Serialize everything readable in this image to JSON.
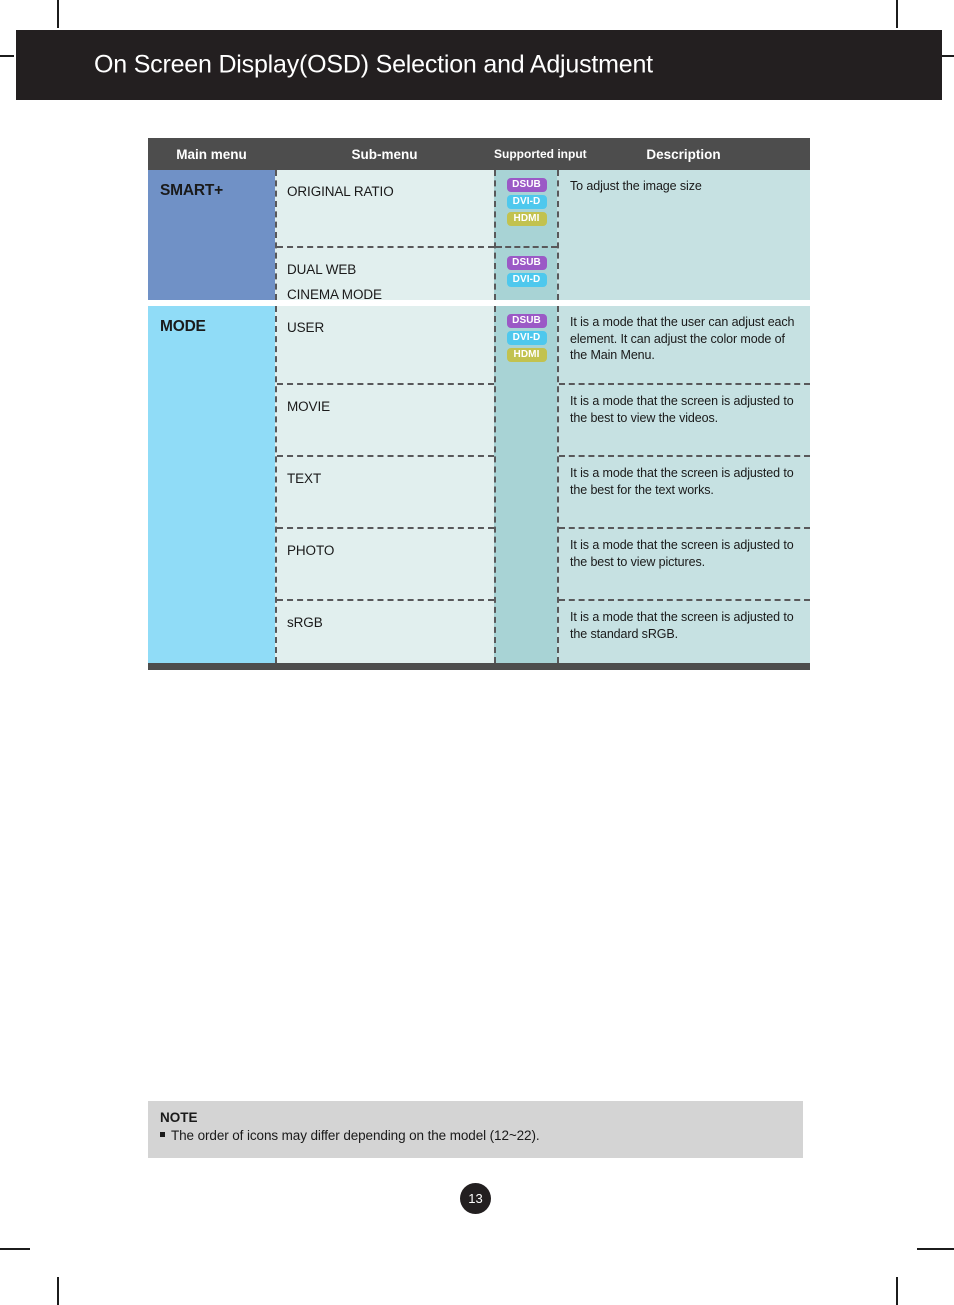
{
  "header": {
    "title": "On Screen Display(OSD) Selection and Adjustment"
  },
  "table": {
    "columns": {
      "main_menu": "Main menu",
      "sub_menu": "Sub-menu",
      "supported_input": "Supported input",
      "description": "Description"
    },
    "sections": [
      {
        "main_menu": "SMART+",
        "sub_rows": [
          {
            "lines": [
              "ORIGINAL RATIO"
            ]
          },
          {
            "lines": [
              "DUAL WEB",
              "CINEMA MODE"
            ]
          }
        ],
        "input_groups": [
          {
            "badges": [
              "DSUB",
              "DVI-D",
              "HDMI"
            ]
          },
          {
            "badges": [
              "DSUB",
              "DVI-D"
            ]
          }
        ],
        "descriptions": [
          "To adjust the image size"
        ]
      },
      {
        "main_menu": "MODE",
        "sub_rows": [
          {
            "lines": [
              "USER"
            ]
          },
          {
            "lines": [
              "MOVIE"
            ]
          },
          {
            "lines": [
              "TEXT"
            ]
          },
          {
            "lines": [
              "PHOTO"
            ]
          },
          {
            "lines": [
              "sRGB"
            ]
          }
        ],
        "input_groups": [
          {
            "badges": [
              "DSUB",
              "DVI-D",
              "HDMI"
            ]
          }
        ],
        "descriptions": [
          "It is a mode that the user can adjust each element.  It can adjust the color mode of the Main Menu.",
          "It is a mode that the screen is adjusted to the best to view the videos.",
          "It is a mode that the screen is adjusted to the best for the text works.",
          "It is a mode that the screen is adjusted to the best to view pictures.",
          "It is a mode that the screen is adjusted to the standard sRGB."
        ]
      }
    ]
  },
  "note": {
    "title": "NOTE",
    "items": [
      "The order of icons may differ depending on the model (12~22)."
    ]
  },
  "page_number": "13",
  "colors": {
    "header_bar": "#231f20",
    "table_header": "#4d4d4d",
    "smart_plus_cell": "#7091c6",
    "mode_cell": "#90dcf7",
    "sub_menu_cell": "#e1efee",
    "input_cell": "#a8d3d5",
    "description_cell": "#c6e1e2",
    "badge_dsub": "#9b59c6",
    "badge_dvid": "#4ec8ed",
    "badge_hdmi": "#c2c24f",
    "note_bg": "#d4d4d4"
  }
}
